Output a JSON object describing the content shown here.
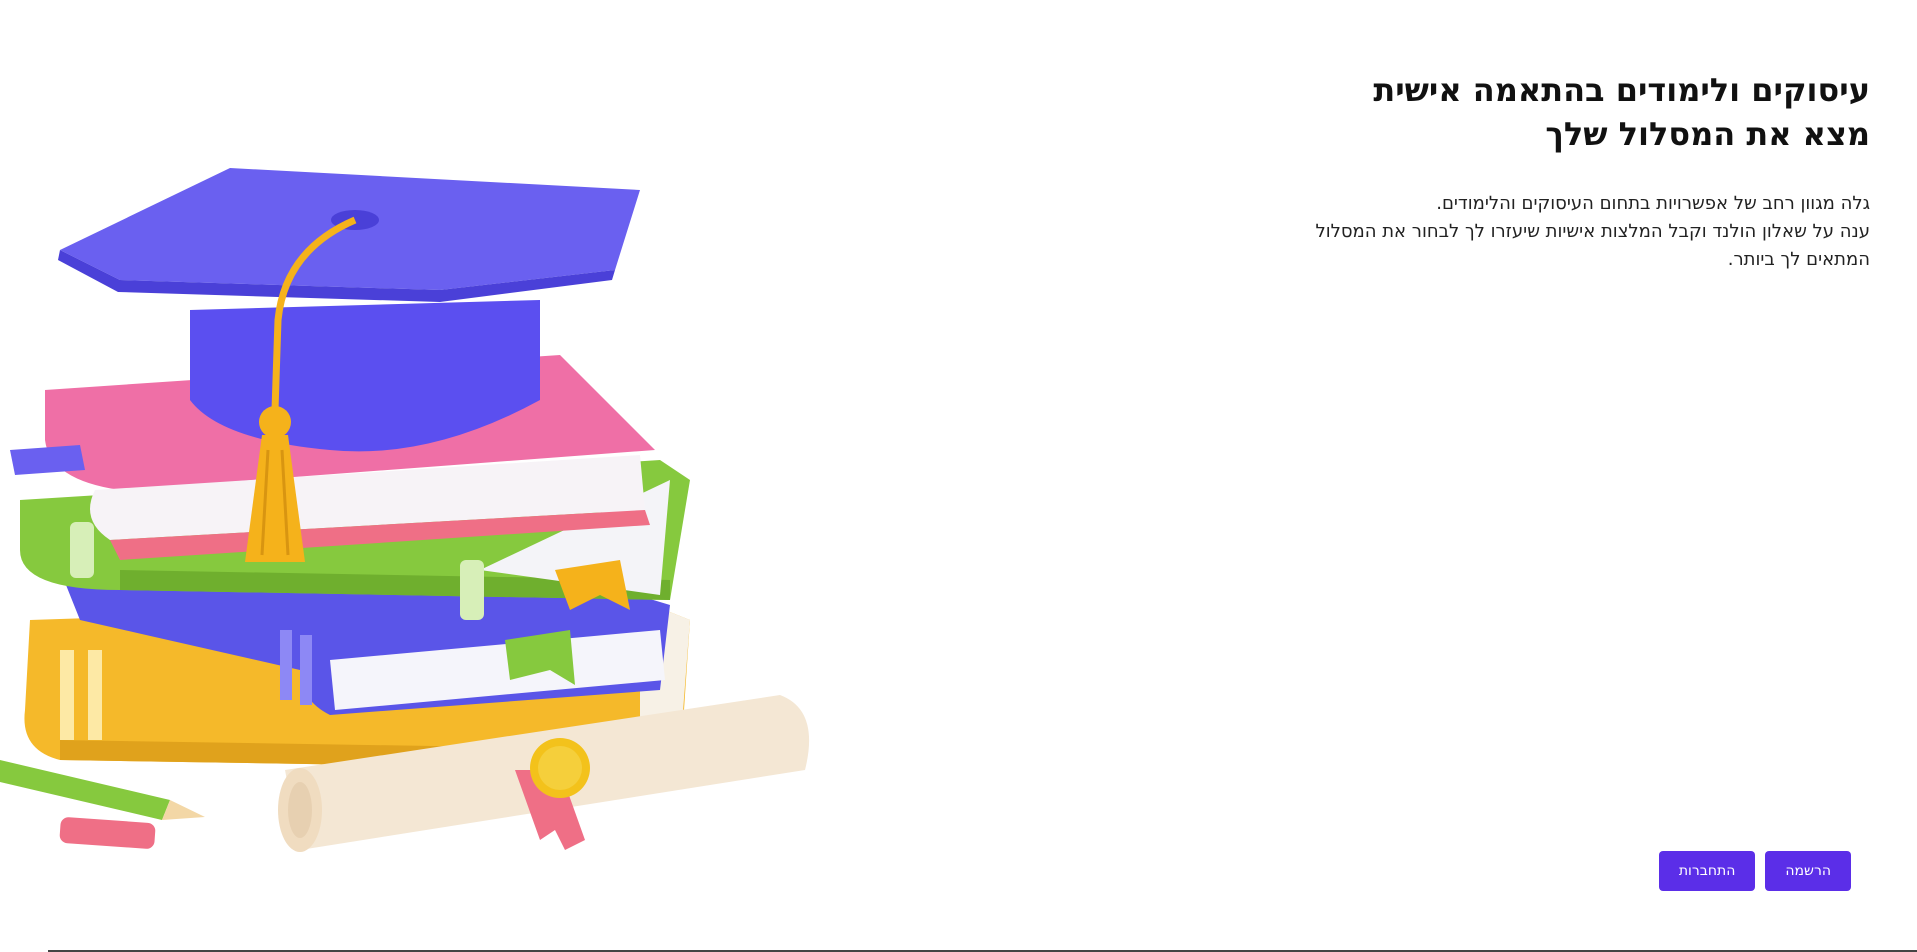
{
  "hero": {
    "title_line1": "עיסוקים ולימודים בהתאמה אישית",
    "title_line2": "מצא את המסלול שלך",
    "description_line1": "גלה מגוון רחב של אפשרויות בתחום העיסוקים והלימודים.",
    "description_line2": "ענה על שאלון הולנד וקבל המלצות אישיות שיעזרו לך לבחור את המסלול",
    "description_line3": "המתאים לך ביותר."
  },
  "actions": {
    "register_label": "הרשמה",
    "login_label": "התחברות"
  },
  "illustration": {
    "icon": "graduation-books-illustration",
    "colors": {
      "cap": "#5b4ff0",
      "tassel": "#f5b21b",
      "pink_book": "#ef6fa6",
      "green_book": "#86c93e",
      "blue_book": "#5a55e8",
      "yellow_book": "#f5b92a",
      "diploma": "#f4e7d4",
      "seal": "#f3c21b",
      "ribbon": "#ef6f86"
    }
  },
  "colors": {
    "accent": "#5b2ee8",
    "text": "#111111",
    "background": "#ffffff"
  }
}
